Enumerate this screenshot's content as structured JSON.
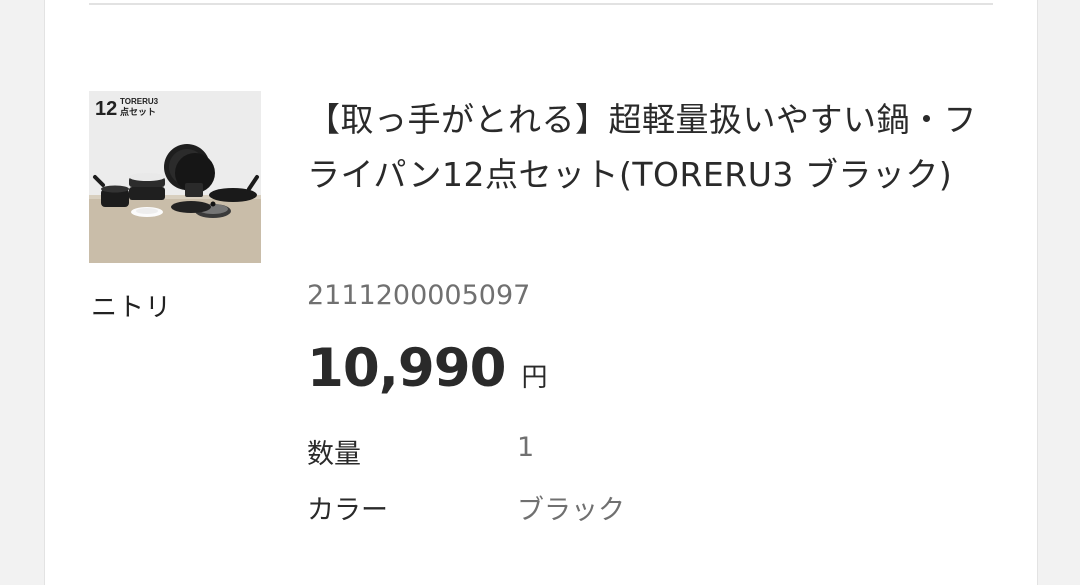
{
  "product": {
    "thumbnail": {
      "badge_number": "12",
      "badge_brand": "TORERU3",
      "badge_text": "点セット"
    },
    "maker": "ニトリ",
    "title": "【取っ手がとれる】超軽量扱いやすい鍋・フライパン12点セット(TORERU3 ブラック)",
    "code": "2111200005097",
    "price": "10,990",
    "price_unit": "円",
    "specs": [
      {
        "label": "数量",
        "value": "1"
      },
      {
        "label": "カラー",
        "value": "ブラック"
      }
    ]
  },
  "colors": {
    "background": "#f2f2f2",
    "card": "#ffffff",
    "text": "#2a2a2a",
    "muted": "#707070"
  }
}
